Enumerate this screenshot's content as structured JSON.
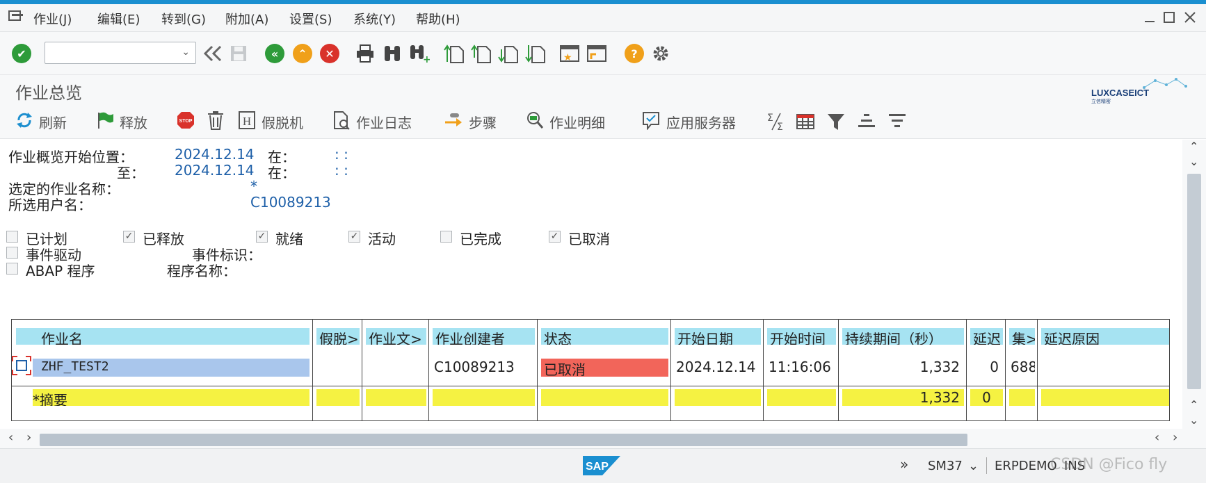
{
  "menubar": {
    "items": [
      "作业(J)",
      "编辑(E)",
      "转到(G)",
      "附加(A)",
      "设置(S)",
      "系统(Y)",
      "帮助(H)"
    ]
  },
  "window_controls": [
    "minimize",
    "maximize",
    "close"
  ],
  "toolbar": {
    "command_field_value": "",
    "icons": [
      "enter-icon",
      "back-double-icon",
      "save-icon",
      "back-icon",
      "exit-icon",
      "cancel-icon",
      "print-icon",
      "find-icon",
      "find-next-icon",
      "first-page-icon",
      "previous-page-icon",
      "next-page-icon",
      "last-page-icon",
      "create-session-icon",
      "shortcut-icon",
      "help-icon",
      "settings-icon"
    ]
  },
  "title": "作业总览",
  "logo_text": "LUXCASEICT",
  "logo_subtext": "立信精密",
  "app_toolbar": {
    "refresh": "刷新",
    "release": "释放",
    "stop": "STOP",
    "hold": "假脱机",
    "job_log": "作业日志",
    "step": "步骤",
    "job_details": "作业明细",
    "app_server": "应用服务器"
  },
  "filters": {
    "start_label": "作业概览开始位置：",
    "start_date": "2024.12.14",
    "at1": "在：",
    "start_time": ":   :",
    "end_label": "至：",
    "end_date": "2024.12.14",
    "at2": "在：",
    "end_time": ":   :",
    "jobname_label": "选定的作业名称：",
    "jobname_value": "*",
    "user_label": "所选用户名：",
    "user_value": "C10089213"
  },
  "status_checks": [
    {
      "label": "已计划",
      "checked": false
    },
    {
      "label": "已释放",
      "checked": true
    },
    {
      "label": "就绪",
      "checked": true
    },
    {
      "label": "活动",
      "checked": true
    },
    {
      "label": "已完成",
      "checked": false
    },
    {
      "label": "已取消",
      "checked": true
    }
  ],
  "event_check": {
    "label": "事件驱动",
    "checked": false,
    "id_label": "事件标识："
  },
  "abap_check": {
    "label": "ABAP 程序",
    "checked": false,
    "prog_label": "程序名称："
  },
  "grid": {
    "headers": [
      "作业名",
      "假脱>",
      "作业文>",
      "作业创建者",
      "状态",
      "开始日期",
      "开始时间",
      "持续期间（秒）",
      "延迟",
      "集>",
      "延迟原因"
    ],
    "rows": [
      {
        "job_name": "ZHF_TEST2",
        "spool": "",
        "job_doc": "",
        "creator": "C10089213",
        "status": "已取消",
        "start_date": "2024.12.14",
        "start_time": "11:16:06",
        "duration": "1,332",
        "delay": "0",
        "set": "688",
        "delay_reason": ""
      }
    ],
    "summary": {
      "label": "*摘要",
      "duration": "1,332",
      "delay": "0"
    }
  },
  "statusbar": {
    "brand": "SAP",
    "transaction": "SM37",
    "system": "ERPDEMO",
    "mode": "INS",
    "watermark": "CSDN @Fico fly"
  },
  "colors": {
    "accent": "#1a8fd0",
    "header_cell": "#a6e3f2",
    "summary_row": "#f5f242",
    "cancelled_status": "#f2655a",
    "selected_cell": "#a9c6ec",
    "value_text": "#1d5fa8"
  }
}
